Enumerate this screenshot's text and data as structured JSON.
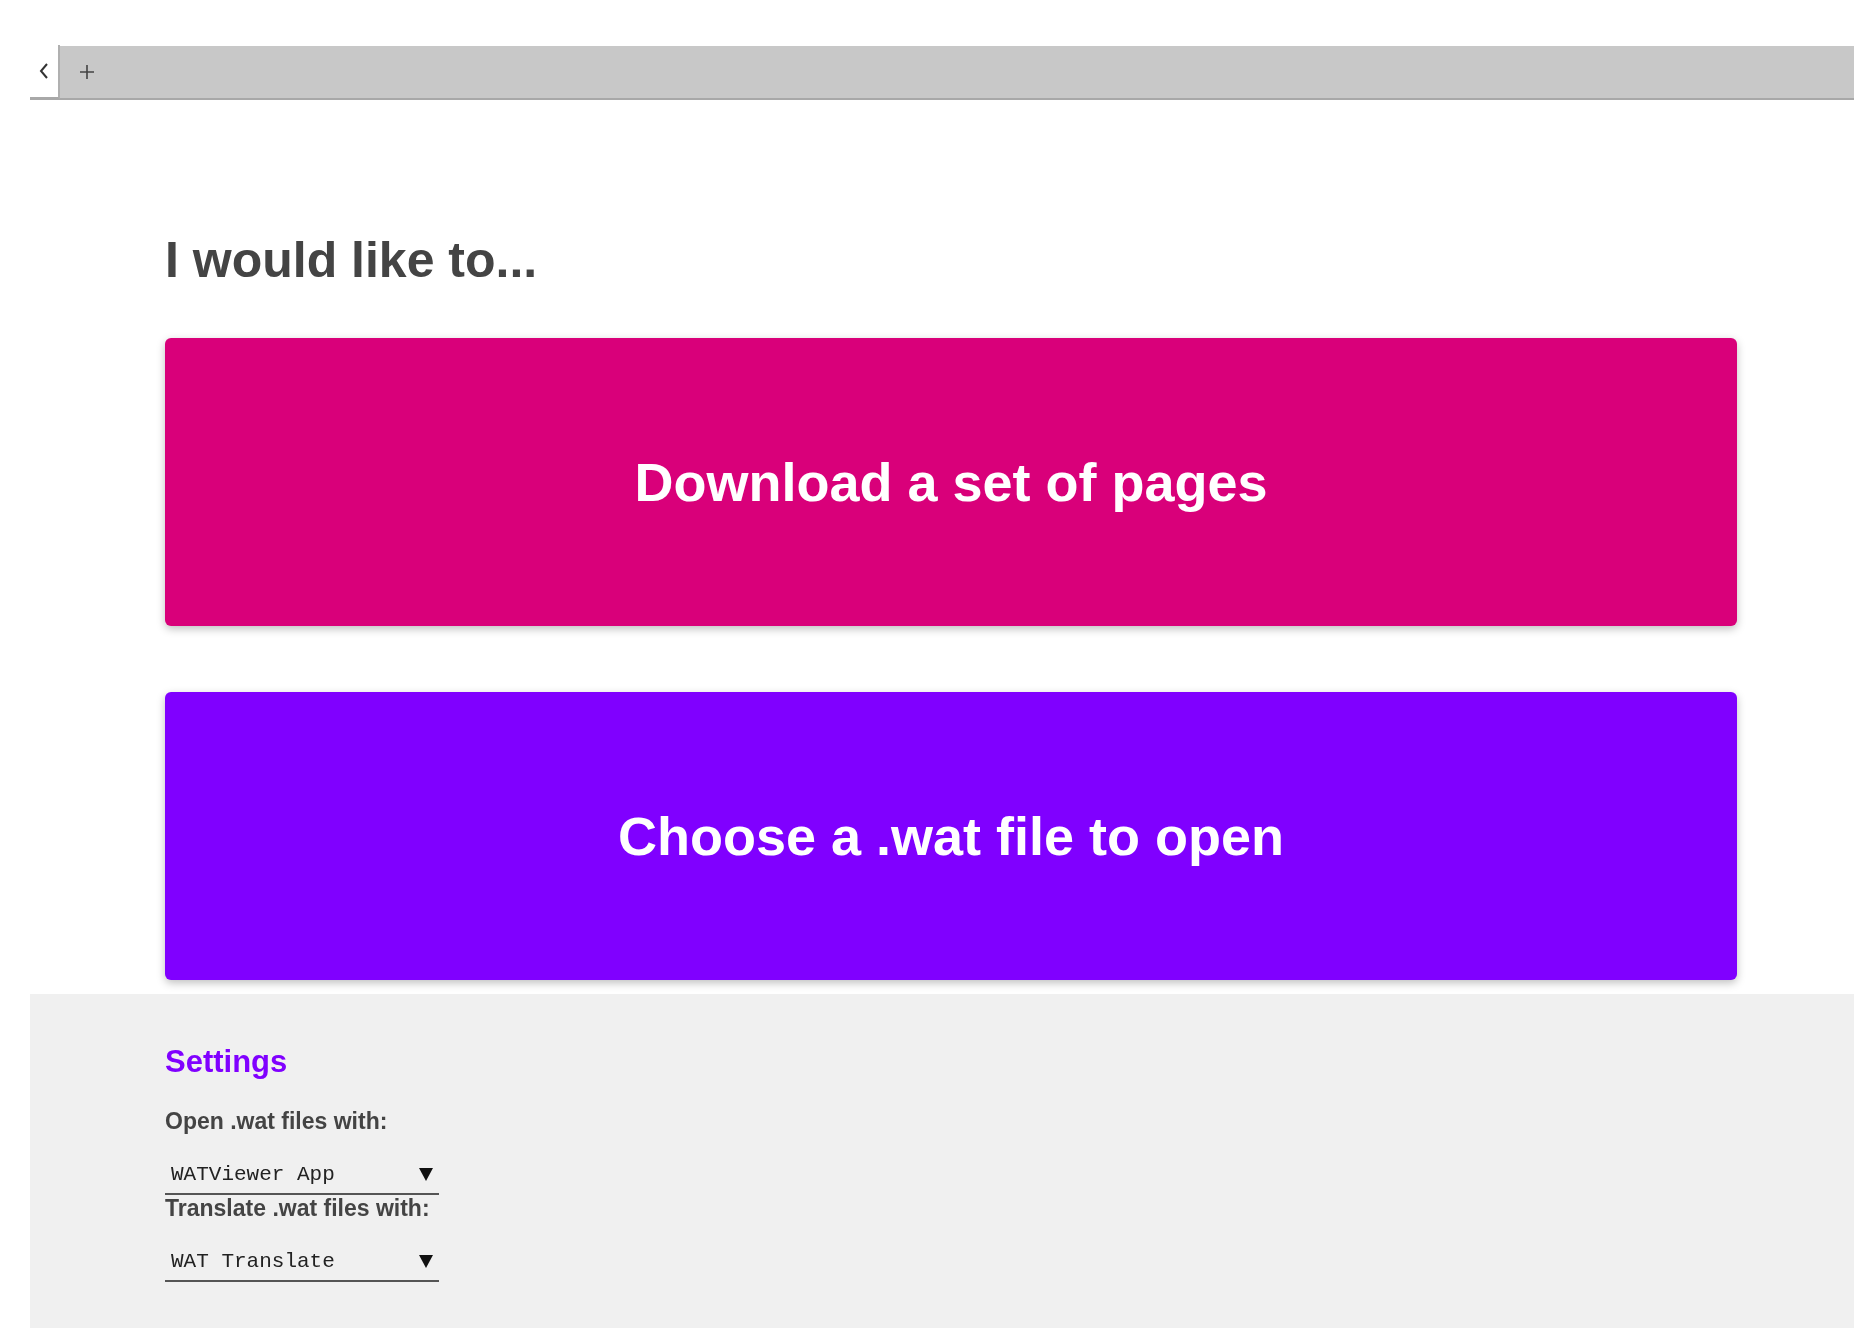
{
  "heading": "I would like to...",
  "actions": [
    {
      "label": "Download a set of pages",
      "color": "#d9007a"
    },
    {
      "label": "Choose a .wat file to open",
      "color": "#8000ff"
    }
  ],
  "settings": {
    "title": "Settings",
    "fields": [
      {
        "label": "Open .wat files with:",
        "value": "WATViewer App"
      },
      {
        "label": "Translate .wat files with:",
        "value": "WAT Translate"
      }
    ]
  }
}
